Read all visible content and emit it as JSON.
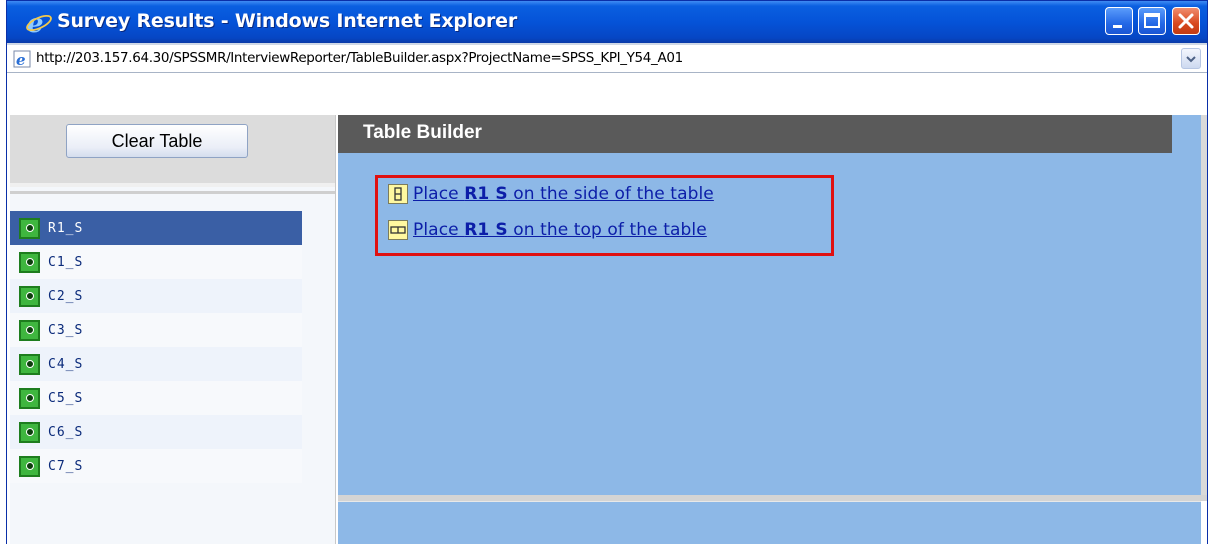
{
  "window": {
    "title": "Survey Results - Windows Internet Explorer",
    "address": "http://203.157.64.30/SPSSMR/InterviewReporter/TableBuilder.aspx?ProjectName=SPSS_KPI_Y54_A01"
  },
  "left_panel": {
    "clear_button_label": "Clear Table",
    "variables": [
      {
        "label": "R1_S",
        "selected": true
      },
      {
        "label": "C1_S",
        "selected": false
      },
      {
        "label": "C2_S",
        "selected": false
      },
      {
        "label": "C3_S",
        "selected": false
      },
      {
        "label": "C4_S",
        "selected": false
      },
      {
        "label": "C5_S",
        "selected": false
      },
      {
        "label": "C6_S",
        "selected": false
      },
      {
        "label": "C7_S",
        "selected": false
      }
    ]
  },
  "table_builder": {
    "header": "Table Builder",
    "options": {
      "side": {
        "prefix": "Place ",
        "variable": "R1  S",
        "suffix": " on the side of the table"
      },
      "top": {
        "prefix": "Place ",
        "variable": "R1  S",
        "suffix": " on the top of the table"
      }
    }
  },
  "colors": {
    "pane_background": "#8db8e7",
    "header_background": "#5a5a5a",
    "selected_item": "#3a5fa5",
    "highlight_border": "#e01010",
    "link": "#0c1ea8"
  },
  "icons": {
    "title": "ie-logo-icon",
    "address": "ie-page-icon",
    "variable": "variable-icon",
    "side_option": "side-placement-icon",
    "top_option": "top-placement-icon"
  }
}
